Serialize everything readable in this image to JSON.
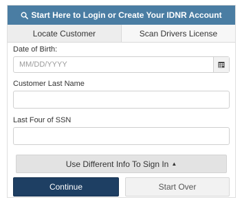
{
  "header": {
    "title": "Start Here to Login or Create Your IDNR Account",
    "icon": "search-icon"
  },
  "tabs": [
    {
      "label": "Locate Customer",
      "active": true
    },
    {
      "label": "Scan Drivers License",
      "active": false
    }
  ],
  "form": {
    "dob": {
      "label": "Date of Birth:",
      "placeholder": "MM/DD/YYYY",
      "value": "",
      "icon": "calendar-icon"
    },
    "last_name": {
      "label": "Customer Last Name",
      "value": ""
    },
    "ssn": {
      "label": "Last Four of SSN",
      "value": ""
    }
  },
  "alt_signin": {
    "label": "Use Different Info To Sign In",
    "icon": "caret-up-icon"
  },
  "actions": {
    "continue_label": "Continue",
    "start_over_label": "Start Over"
  },
  "colors": {
    "header_bg": "#4a7da3",
    "continue_bg": "#1e3f63",
    "tab_active_bg": "#ededed"
  }
}
